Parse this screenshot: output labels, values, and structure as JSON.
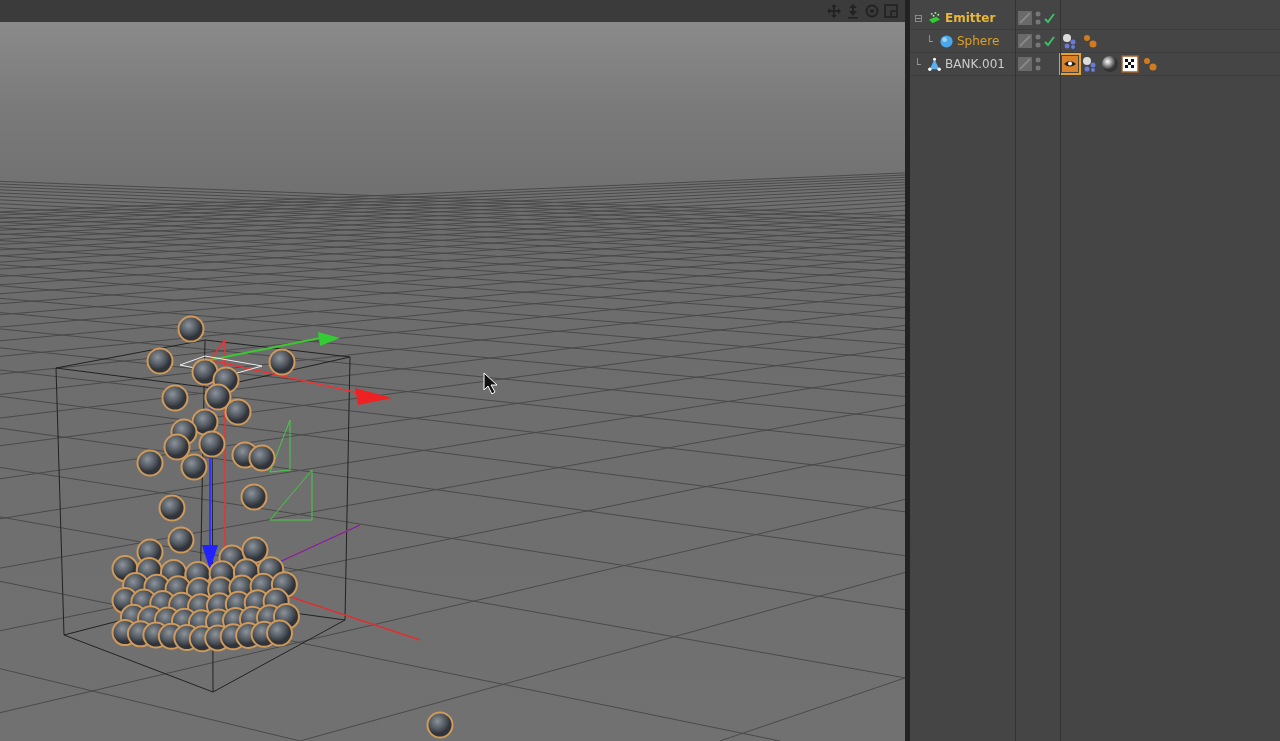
{
  "viewport": {
    "nav_icons": [
      {
        "kind": "move"
      },
      {
        "kind": "zoom"
      },
      {
        "kind": "rotate"
      },
      {
        "kind": "layout"
      }
    ]
  },
  "object_manager": {
    "objects": [
      {
        "name": "Emitter",
        "kind": "emitter",
        "expander": "⊟",
        "selected": true,
        "enabled": true,
        "children": [
          {
            "name": "Sphere",
            "kind": "sphere",
            "expander": "└",
            "selected": true,
            "enabled": true,
            "tags": [
              {
                "kind": "particle",
                "selected": false
              },
              {
                "kind": "dots",
                "selected": false
              }
            ]
          }
        ]
      },
      {
        "name": "BANK.001",
        "kind": "cone",
        "expander": "└",
        "selected": false,
        "enabled": false,
        "tags": [
          {
            "kind": "display",
            "selected": true
          },
          {
            "kind": "particle",
            "selected": false
          },
          {
            "kind": "material",
            "selected": false
          },
          {
            "kind": "checker",
            "selected": false
          },
          {
            "kind": "dots",
            "selected": false
          }
        ]
      }
    ]
  }
}
